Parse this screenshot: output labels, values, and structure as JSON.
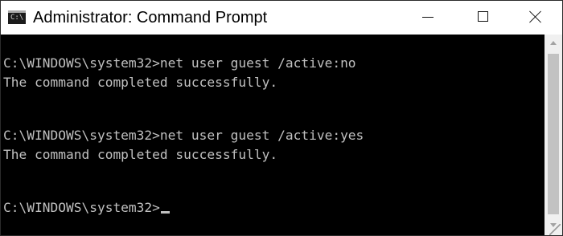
{
  "window": {
    "title": "Administrator: Command Prompt",
    "icon": "command-prompt-icon",
    "icon_glyph": "C:\\",
    "controls": {
      "minimize": "minimize-icon",
      "maximize": "maximize-icon",
      "close": "close-icon"
    }
  },
  "console": {
    "lines": [
      "C:\\WINDOWS\\system32>net user guest /active:no",
      "The command completed successfully.",
      "C:\\WINDOWS\\system32>net user guest /active:yes",
      "The command completed successfully.",
      "C:\\WINDOWS\\system32>"
    ]
  },
  "colors": {
    "console_background": "#000000",
    "console_text": "#c0c0c0",
    "titlebar": "#ffffff"
  }
}
